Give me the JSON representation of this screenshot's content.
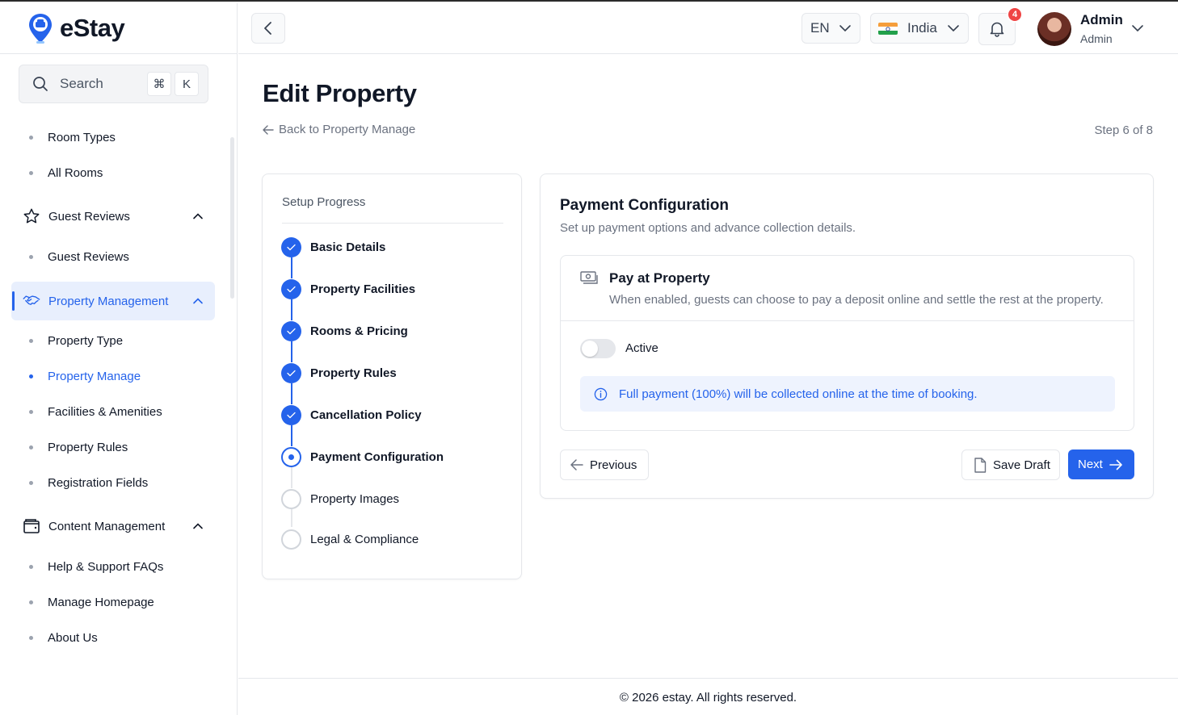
{
  "app": {
    "name": "eStay"
  },
  "search": {
    "label": "Search",
    "key_cmd": "⌘",
    "key_k": "K"
  },
  "sidebar": {
    "items": [
      {
        "type": "sub",
        "label": "Room Types"
      },
      {
        "type": "sub",
        "label": "All Rooms"
      },
      {
        "type": "group",
        "label": "Guest Reviews",
        "icon": "star-icon",
        "expanded": true
      },
      {
        "type": "sub",
        "label": "Guest Reviews"
      },
      {
        "type": "group",
        "label": "Property Management",
        "icon": "handshake-icon",
        "expanded": true,
        "active": true
      },
      {
        "type": "sub",
        "label": "Property Type"
      },
      {
        "type": "sub",
        "label": "Property Manage",
        "active": true
      },
      {
        "type": "sub",
        "label": "Facilities & Amenities"
      },
      {
        "type": "sub",
        "label": "Property Rules"
      },
      {
        "type": "sub",
        "label": "Registration Fields"
      },
      {
        "type": "group",
        "label": "Content Management",
        "icon": "wallet-icon",
        "expanded": true
      },
      {
        "type": "sub",
        "label": "Help & Support FAQs"
      },
      {
        "type": "sub",
        "label": "Manage Homepage"
      },
      {
        "type": "sub",
        "label": "About Us"
      }
    ]
  },
  "topbar": {
    "language": "EN",
    "country": "India",
    "notification_count": "4",
    "user_name": "Admin",
    "user_role": "Admin"
  },
  "page": {
    "title": "Edit Property",
    "back_link": "Back to Property Manage",
    "step_indicator": "Step 6 of 8"
  },
  "setup_progress": {
    "title": "Setup Progress",
    "steps": [
      {
        "label": "Basic Details",
        "status": "done"
      },
      {
        "label": "Property Facilities",
        "status": "done"
      },
      {
        "label": "Rooms & Pricing",
        "status": "done"
      },
      {
        "label": "Property Rules",
        "status": "done"
      },
      {
        "label": "Cancellation Policy",
        "status": "done"
      },
      {
        "label": "Payment Configuration",
        "status": "current"
      },
      {
        "label": "Property Images",
        "status": "todo"
      },
      {
        "label": "Legal & Compliance",
        "status": "todo"
      }
    ]
  },
  "payment": {
    "title": "Payment Configuration",
    "subtitle": "Set up payment options and advance collection details.",
    "option_title": "Pay at Property",
    "option_desc": "When enabled, guests can choose to pay a deposit online and settle the rest at the property.",
    "toggle_label": "Active",
    "toggle_on": false,
    "info_text": "Full payment (100%) will be collected online at the time of booking."
  },
  "actions": {
    "previous": "Previous",
    "save_draft": "Save Draft",
    "next": "Next"
  },
  "footer": {
    "text": "© 2026 estay. All rights reserved."
  },
  "colors": {
    "accent": "#2563eb",
    "badge": "#ef4444",
    "active_bg": "#e8effd"
  }
}
